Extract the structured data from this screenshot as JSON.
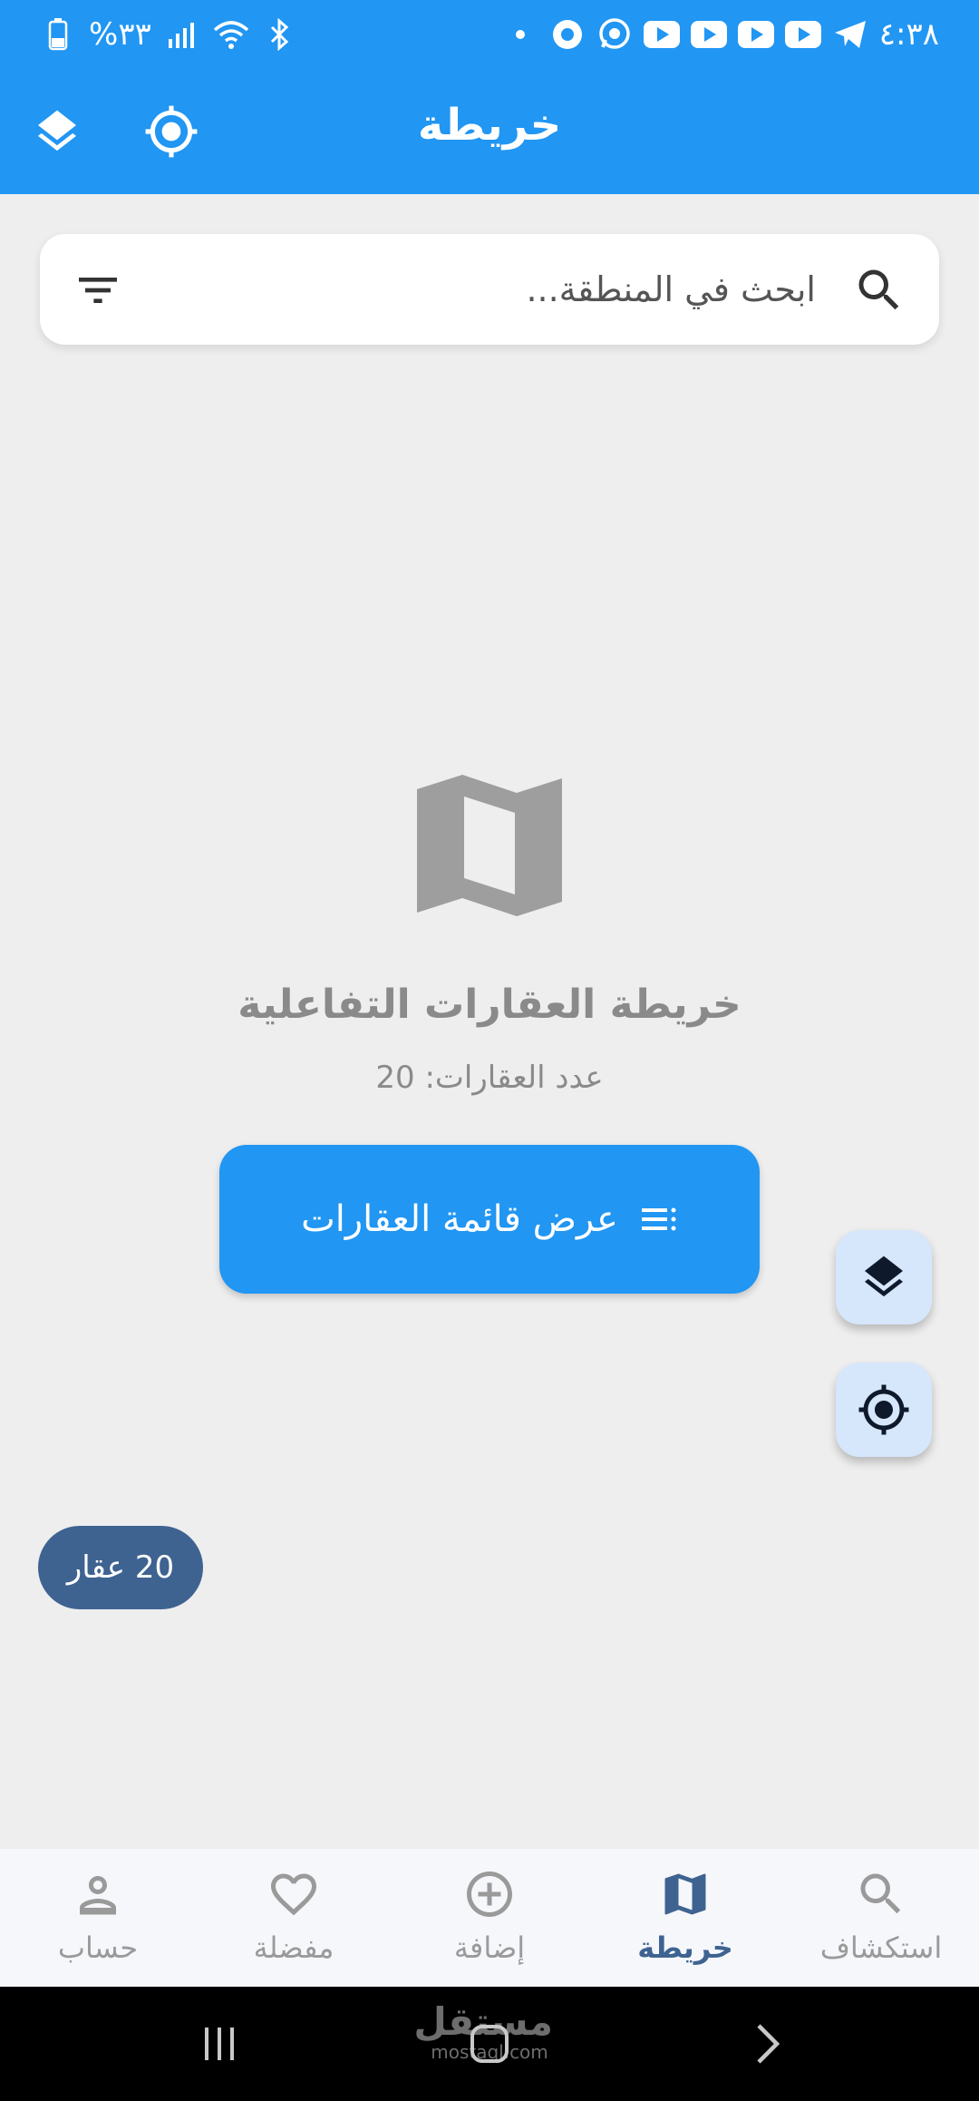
{
  "status_bar": {
    "time": "٤:٣٨",
    "battery": "%٣٣",
    "icons": [
      "telegram-icon",
      "youtube-icon",
      "youtube-icon",
      "youtube-icon",
      "youtube-icon",
      "whatsapp-icon",
      "notification-icon",
      "dot-icon",
      "bluetooth-icon",
      "wifi-icon",
      "signal-icon",
      "battery-icon"
    ]
  },
  "app_bar": {
    "title": "خريطة",
    "actions": [
      "layers-icon",
      "my-location-icon"
    ]
  },
  "search": {
    "placeholder": "ابحث في المنطقة..."
  },
  "center": {
    "title": "خريطة العقارات التفاعلية",
    "count_text": "عدد العقارات: 20",
    "button_label": "عرض قائمة العقارات"
  },
  "chip": {
    "text": "20 عقار"
  },
  "bottom_nav": {
    "items": [
      {
        "label": "حساب",
        "icon": "person-icon"
      },
      {
        "label": "مفضلة",
        "icon": "heart-icon"
      },
      {
        "label": "إضافة",
        "icon": "add-circle-icon"
      },
      {
        "label": "خريطة",
        "icon": "map-icon",
        "active": true
      },
      {
        "label": "استكشاف",
        "icon": "search-icon"
      }
    ]
  },
  "system_nav": {
    "watermark": "مستقل",
    "watermark_sub": "mostaql.com"
  },
  "colors": {
    "primary": "#2196F3",
    "nav_active": "#3E6391",
    "fab_bg": "#D6E6FB",
    "background": "#EEEEEE"
  }
}
